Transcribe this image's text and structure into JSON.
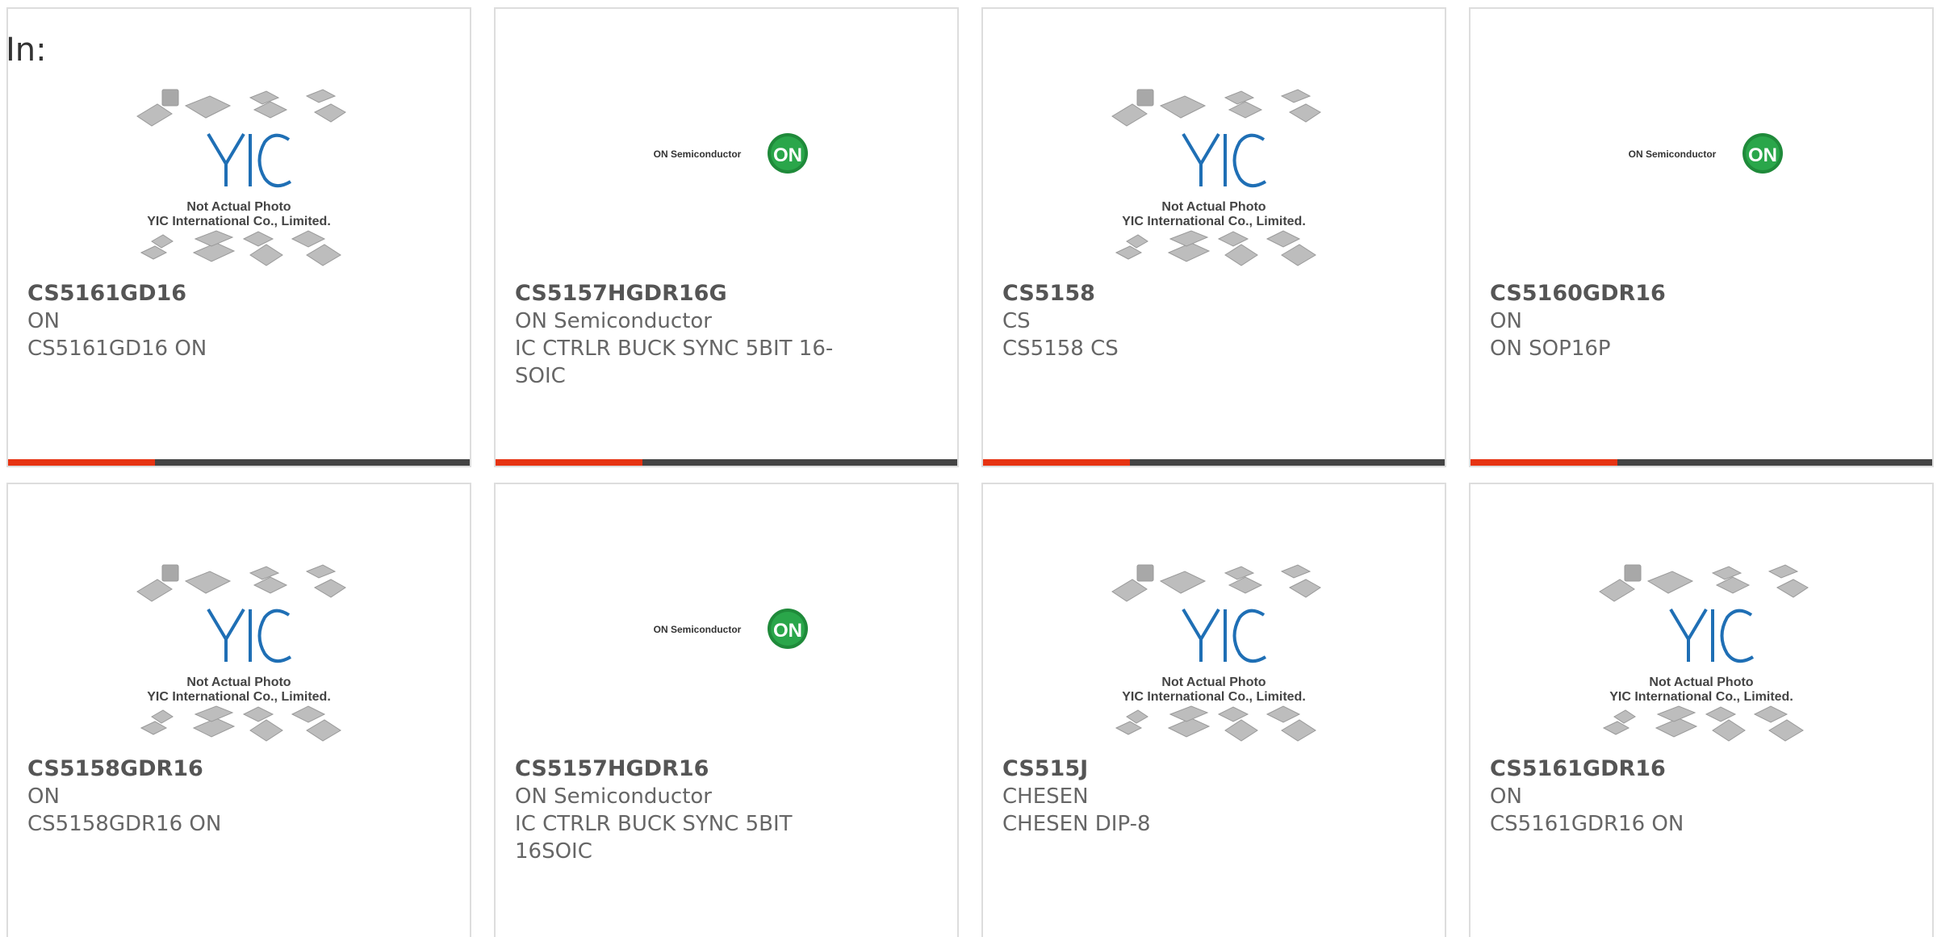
{
  "header": {
    "label": "In:"
  },
  "accent_color": "#e63312",
  "bar_color": "#444444",
  "yic_thumb": {
    "line1": "Not Actual Photo",
    "line2": "YIC International Co., Limited."
  },
  "on_thumb": {
    "wordmark": "ON Semiconductor",
    "badge": "ON"
  },
  "products": [
    {
      "part": "CS5161GD16",
      "maker": "ON",
      "desc": "CS5161GD16 ON",
      "image": "yic-placeholder"
    },
    {
      "part": "CS5157HGDR16G",
      "maker": "ON Semiconductor",
      "desc": "IC CTRLR BUCK SYNC 5BIT 16-SOIC",
      "image": "on-semi-logo"
    },
    {
      "part": "CS5158",
      "maker": "CS",
      "desc": "CS5158 CS",
      "image": "yic-placeholder"
    },
    {
      "part": "CS5160GDR16",
      "maker": "ON",
      "desc": "ON SOP16P",
      "image": "on-semi-logo"
    },
    {
      "part": "CS5158GDR16",
      "maker": "ON",
      "desc": "CS5158GDR16 ON",
      "image": "yic-placeholder"
    },
    {
      "part": "CS5157HGDR16",
      "maker": "ON Semiconductor",
      "desc": "IC CTRLR BUCK SYNC 5BIT 16SOIC",
      "image": "on-semi-logo"
    },
    {
      "part": "CS515J",
      "maker": "CHESEN",
      "desc": "CHESEN DIP-8",
      "image": "yic-placeholder"
    },
    {
      "part": "CS5161GDR16",
      "maker": "ON",
      "desc": "CS5161GDR16 ON",
      "image": "yic-placeholder"
    }
  ]
}
